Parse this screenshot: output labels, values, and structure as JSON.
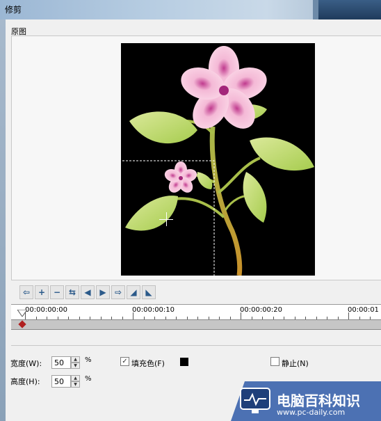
{
  "window": {
    "title": "修剪"
  },
  "preview": {
    "group_label": "原图"
  },
  "toolbar": {
    "buttons": [
      "arrow-left-icon",
      "plus-icon",
      "minus-icon",
      "swap-icon",
      "prev-frame-icon",
      "next-frame-icon",
      "arrow-right-icon",
      "rotate-left-icon",
      "rotate-right-icon"
    ]
  },
  "timeline": {
    "timecodes": [
      "00:00:00:00",
      "00:00:00:10",
      "00:00:00:20",
      "00:00:01"
    ]
  },
  "size": {
    "width_label": "宽度(W):",
    "width_value": "50",
    "height_label": "高度(H):",
    "height_value": "50",
    "unit": "%"
  },
  "fill": {
    "label": "填充色(F)",
    "checked": true,
    "color": "#000000"
  },
  "still": {
    "label": "静止(N)",
    "checked": false
  },
  "watermark": {
    "main": "电脑百科知识",
    "url": "www.pc-daily.com"
  }
}
